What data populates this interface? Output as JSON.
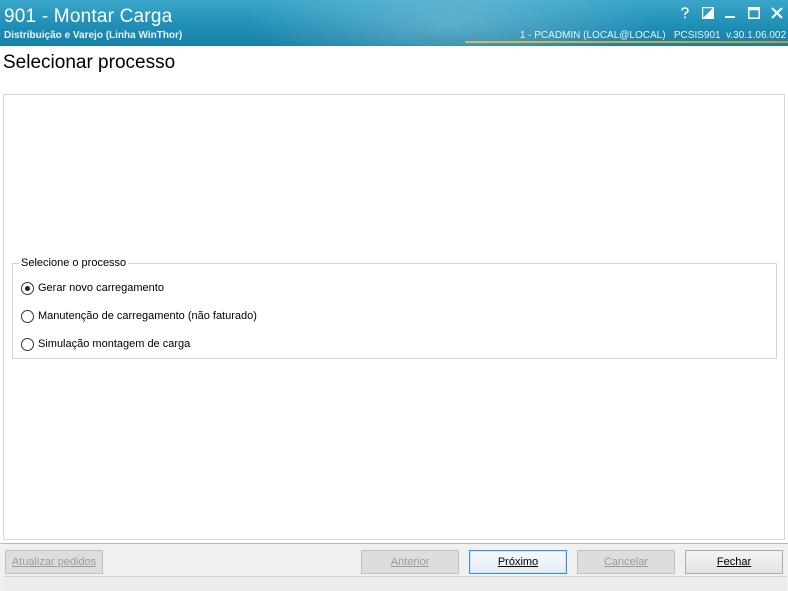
{
  "window": {
    "title": "901 - Montar Carga",
    "subtitle": "Distribuição e Varejo (Linha WinThor)",
    "status": "1 - PCADMIN (LOCAL@LOCAL)   PCSIS901  v.30.1.06.002",
    "controls": [
      "help-icon",
      "restore-panel-icon",
      "minimize-icon",
      "maximize-icon",
      "close-icon"
    ]
  },
  "page": {
    "heading": "Selecionar processo"
  },
  "process_group": {
    "legend": "Selecione o processo",
    "options": [
      {
        "label": "Gerar novo carregamento",
        "selected": true
      },
      {
        "label": "Manutenção de carregamento (não faturado)",
        "selected": false
      },
      {
        "label": "Simulação montagem de carga",
        "selected": false
      }
    ]
  },
  "buttons": {
    "update_orders": {
      "label": "Atualizar pedidos",
      "enabled": false
    },
    "previous": {
      "label": "Anterior",
      "enabled": false
    },
    "next": {
      "label": "Próximo",
      "enabled": true
    },
    "cancel": {
      "label": "Cancelar",
      "enabled": false
    },
    "close": {
      "label": "Fechar",
      "enabled": true
    }
  },
  "colors": {
    "titlebar": "#1f8fb6",
    "accent_line": "#d4aa35",
    "focus_border": "#3b8ed1"
  }
}
